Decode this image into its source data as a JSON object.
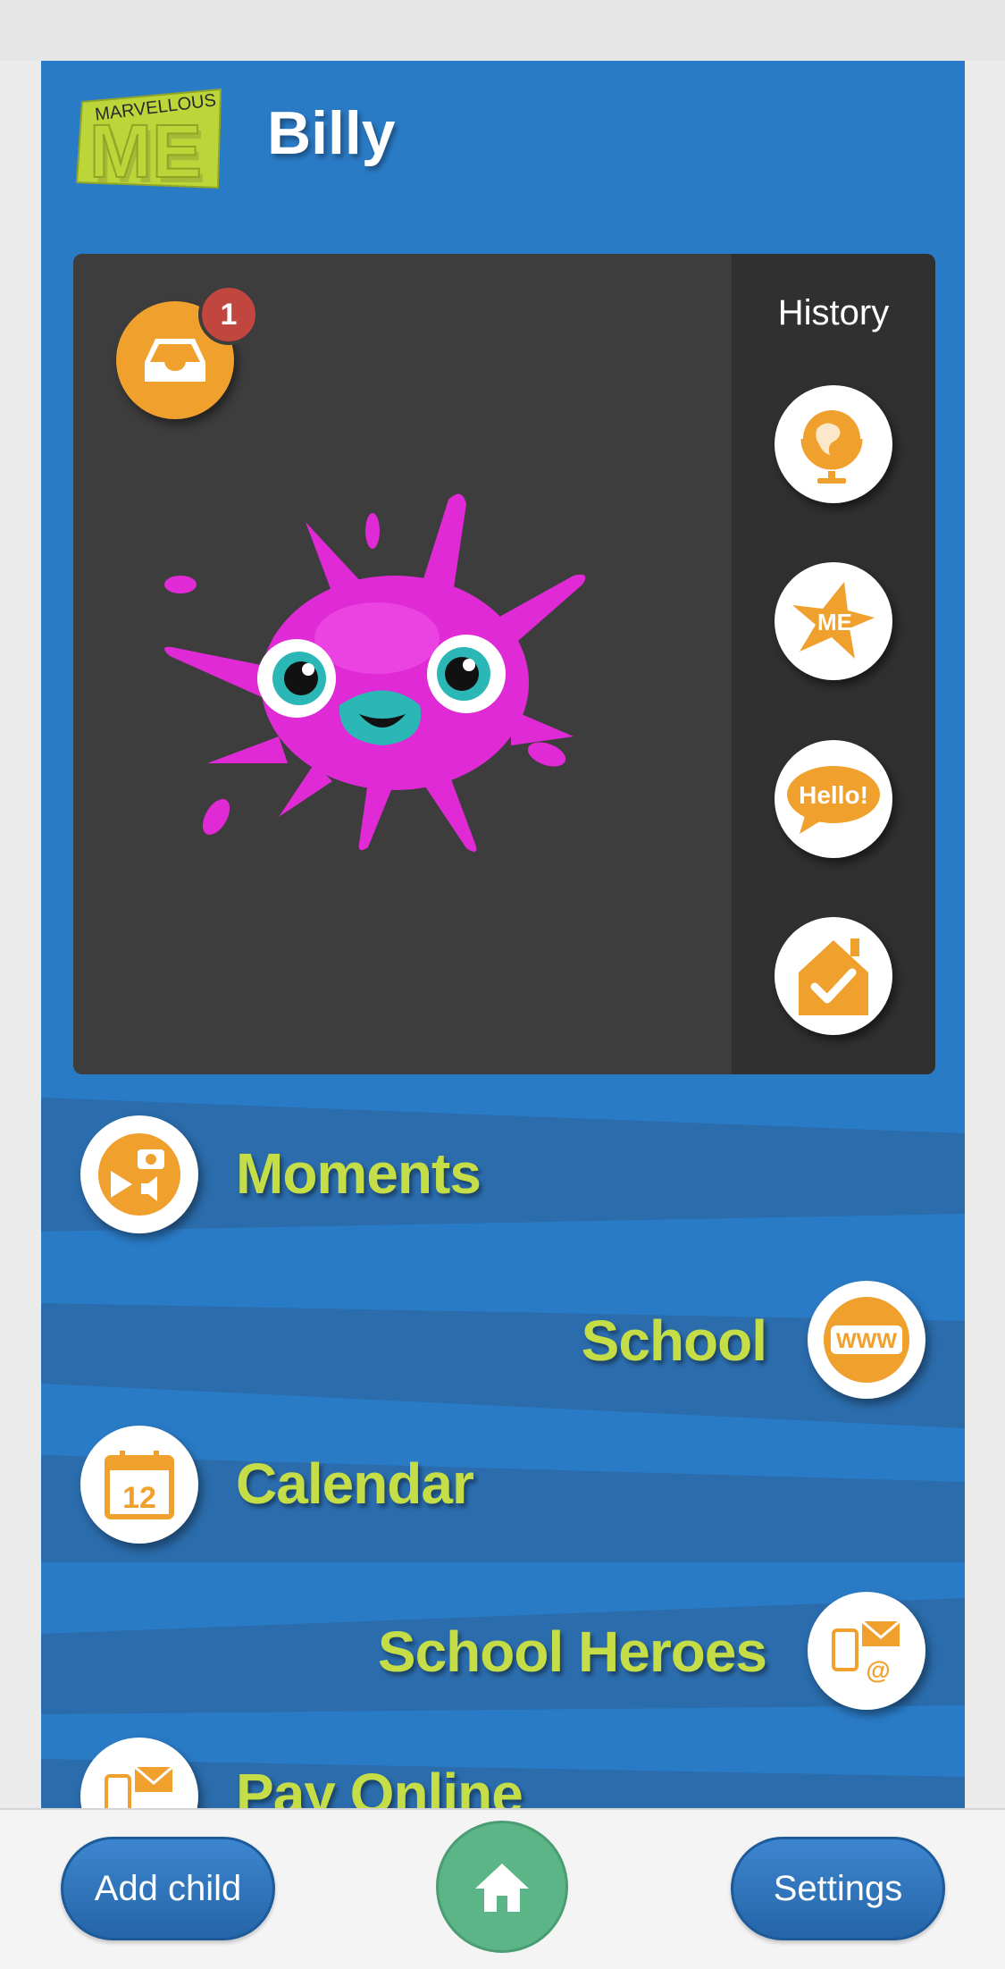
{
  "header": {
    "logo_top": "MARVELLOUS",
    "logo_main": "ME",
    "child_name": "Billy"
  },
  "card": {
    "inbox_badge": "1",
    "history_title": "History",
    "history_icons": [
      "globe-icon",
      "star-me-icon",
      "hello-bubble-icon",
      "home-check-icon"
    ],
    "hello_text": "Hello!"
  },
  "menu": {
    "items": [
      {
        "label": "Moments",
        "icon": "camera-play-icon"
      },
      {
        "label": "School",
        "icon": "www-icon"
      },
      {
        "label": "Calendar",
        "icon": "calendar-icon",
        "icon_text": "12"
      },
      {
        "label": "School Heroes",
        "icon": "phone-mail-icon"
      },
      {
        "label": "Pay Online",
        "icon": "phone-mail-icon"
      }
    ]
  },
  "bottom_bar": {
    "add_child": "Add child",
    "settings": "Settings",
    "home_icon": "home-icon"
  },
  "colors": {
    "panel_blue": "#2a7bc6",
    "accent_orange": "#f0a02d",
    "label_green": "#c5dd47",
    "monster_pink": "#e02ad6",
    "home_green": "#5cb587"
  }
}
